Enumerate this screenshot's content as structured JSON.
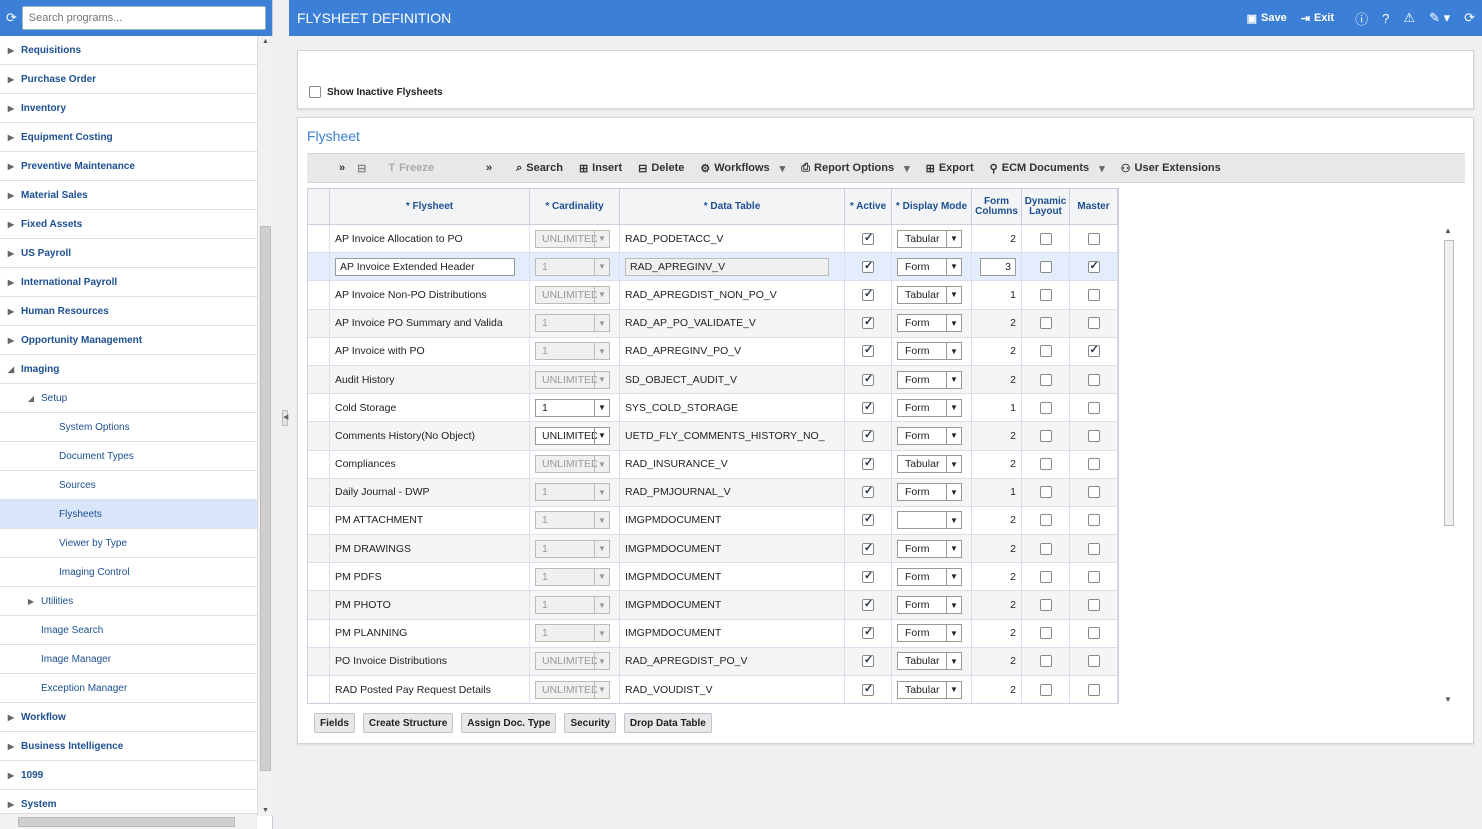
{
  "sidebar": {
    "search_placeholder": "Search programs...",
    "items": [
      {
        "label": "Requisitions",
        "level": 0,
        "arrow": "▶"
      },
      {
        "label": "Purchase Order",
        "level": 0,
        "arrow": "▶"
      },
      {
        "label": "Inventory",
        "level": 0,
        "arrow": "▶"
      },
      {
        "label": "Equipment Costing",
        "level": 0,
        "arrow": "▶"
      },
      {
        "label": "Preventive Maintenance",
        "level": 0,
        "arrow": "▶"
      },
      {
        "label": "Material Sales",
        "level": 0,
        "arrow": "▶"
      },
      {
        "label": "Fixed Assets",
        "level": 0,
        "arrow": "▶"
      },
      {
        "label": "US Payroll",
        "level": 0,
        "arrow": "▶"
      },
      {
        "label": "International Payroll",
        "level": 0,
        "arrow": "▶"
      },
      {
        "label": "Human Resources",
        "level": 0,
        "arrow": "▶"
      },
      {
        "label": "Opportunity Management",
        "level": 0,
        "arrow": "▶"
      },
      {
        "label": "Imaging",
        "level": 0,
        "arrow": "◢"
      },
      {
        "label": "Setup",
        "level": 1,
        "arrow": "◢"
      },
      {
        "label": "System Options",
        "level": 2,
        "arrow": ""
      },
      {
        "label": "Document Types",
        "level": 2,
        "arrow": ""
      },
      {
        "label": "Sources",
        "level": 2,
        "arrow": ""
      },
      {
        "label": "Flysheets",
        "level": 2,
        "arrow": "",
        "selected": true
      },
      {
        "label": "Viewer by Type",
        "level": 2,
        "arrow": ""
      },
      {
        "label": "Imaging Control",
        "level": 2,
        "arrow": ""
      },
      {
        "label": "Utilities",
        "level": 1,
        "arrow": "▶"
      },
      {
        "label": "Image Search",
        "level": 1,
        "arrow": ""
      },
      {
        "label": "Image Manager",
        "level": 1,
        "arrow": ""
      },
      {
        "label": "Exception Manager",
        "level": 1,
        "arrow": ""
      },
      {
        "label": "Workflow",
        "level": 0,
        "arrow": "▶"
      },
      {
        "label": "Business Intelligence",
        "level": 0,
        "arrow": "▶"
      },
      {
        "label": "1099",
        "level": 0,
        "arrow": "▶"
      },
      {
        "label": "System",
        "level": 0,
        "arrow": "▶"
      }
    ]
  },
  "header": {
    "title": "FLYSHEET DEFINITION",
    "save": "Save",
    "exit": "Exit"
  },
  "filter": {
    "show_inactive": "Show Inactive Flysheets"
  },
  "panel": {
    "title": "Flysheet"
  },
  "toolbar": {
    "freeze": "Freeze",
    "search": "Search",
    "insert": "Insert",
    "delete": "Delete",
    "workflows": "Workflows",
    "report_options": "Report Options",
    "export": "Export",
    "ecm": "ECM Documents",
    "user_ext": "User Extensions"
  },
  "columns": [
    "* Flysheet",
    "* Cardinality",
    "* Data Table",
    "* Active",
    "* Display Mode",
    "Form Columns",
    "Dynamic Layout",
    "Master"
  ],
  "rows": [
    {
      "flysheet": "AP Invoice Allocation to PO",
      "card": "UNLIMITED",
      "card_en": false,
      "table": "RAD_PODETACC_V",
      "active": true,
      "mode": "Tabular",
      "cols": "2",
      "dyn": false,
      "master": false
    },
    {
      "flysheet": "AP Invoice Extended Header",
      "card": "1",
      "card_en": false,
      "table": "RAD_APREGINV_V",
      "active": true,
      "mode": "Form",
      "cols": "3",
      "dyn": false,
      "master": true,
      "selected": true
    },
    {
      "flysheet": "AP Invoice Non-PO Distributions",
      "card": "UNLIMITED",
      "card_en": false,
      "table": "RAD_APREGDIST_NON_PO_V",
      "active": true,
      "mode": "Tabular",
      "cols": "1",
      "dyn": false,
      "master": false
    },
    {
      "flysheet": "AP Invoice PO Summary and Valida",
      "card": "1",
      "card_en": false,
      "table": "RAD_AP_PO_VALIDATE_V",
      "active": true,
      "mode": "Form",
      "cols": "2",
      "dyn": false,
      "master": false
    },
    {
      "flysheet": "AP Invoice with PO",
      "card": "1",
      "card_en": false,
      "table": "RAD_APREGINV_PO_V",
      "active": true,
      "mode": "Form",
      "cols": "2",
      "dyn": false,
      "master": true
    },
    {
      "flysheet": "Audit History",
      "card": "UNLIMITED",
      "card_en": false,
      "table": "SD_OBJECT_AUDIT_V",
      "active": true,
      "mode": "Form",
      "cols": "2",
      "dyn": false,
      "master": false
    },
    {
      "flysheet": "Cold Storage",
      "card": "1",
      "card_en": true,
      "table": "SYS_COLD_STORAGE",
      "active": true,
      "mode": "Form",
      "cols": "1",
      "dyn": false,
      "master": false
    },
    {
      "flysheet": "Comments History(No Object)",
      "card": "UNLIMITED",
      "card_en": true,
      "table": "UETD_FLY_COMMENTS_HISTORY_NO_",
      "active": true,
      "mode": "Form",
      "cols": "2",
      "dyn": false,
      "master": false
    },
    {
      "flysheet": "Compliances",
      "card": "UNLIMITED",
      "card_en": false,
      "table": "RAD_INSURANCE_V",
      "active": true,
      "mode": "Tabular",
      "cols": "2",
      "dyn": false,
      "master": false
    },
    {
      "flysheet": "Daily Journal - DWP",
      "card": "1",
      "card_en": false,
      "table": "RAD_PMJOURNAL_V",
      "active": true,
      "mode": "Form",
      "cols": "1",
      "dyn": false,
      "master": false
    },
    {
      "flysheet": "PM ATTACHMENT",
      "card": "1",
      "card_en": false,
      "table": "IMGPMDOCUMENT",
      "active": true,
      "mode": "",
      "cols": "2",
      "dyn": false,
      "master": false
    },
    {
      "flysheet": "PM DRAWINGS",
      "card": "1",
      "card_en": false,
      "table": "IMGPMDOCUMENT",
      "active": true,
      "mode": "Form",
      "cols": "2",
      "dyn": false,
      "master": false
    },
    {
      "flysheet": "PM PDFS",
      "card": "1",
      "card_en": false,
      "table": "IMGPMDOCUMENT",
      "active": true,
      "mode": "Form",
      "cols": "2",
      "dyn": false,
      "master": false
    },
    {
      "flysheet": "PM PHOTO",
      "card": "1",
      "card_en": false,
      "table": "IMGPMDOCUMENT",
      "active": true,
      "mode": "Form",
      "cols": "2",
      "dyn": false,
      "master": false
    },
    {
      "flysheet": "PM PLANNING",
      "card": "1",
      "card_en": false,
      "table": "IMGPMDOCUMENT",
      "active": true,
      "mode": "Form",
      "cols": "2",
      "dyn": false,
      "master": false
    },
    {
      "flysheet": "PO Invoice Distributions",
      "card": "UNLIMITED",
      "card_en": false,
      "table": "RAD_APREGDIST_PO_V",
      "active": true,
      "mode": "Tabular",
      "cols": "2",
      "dyn": false,
      "master": false
    },
    {
      "flysheet": "RAD Posted Pay Request Details",
      "card": "UNLIMITED",
      "card_en": false,
      "table": "RAD_VOUDIST_V",
      "active": true,
      "mode": "Tabular",
      "cols": "2",
      "dyn": false,
      "master": false
    }
  ],
  "buttons": [
    "Fields",
    "Create Structure",
    "Assign Doc. Type",
    "Security",
    "Drop Data Table"
  ]
}
